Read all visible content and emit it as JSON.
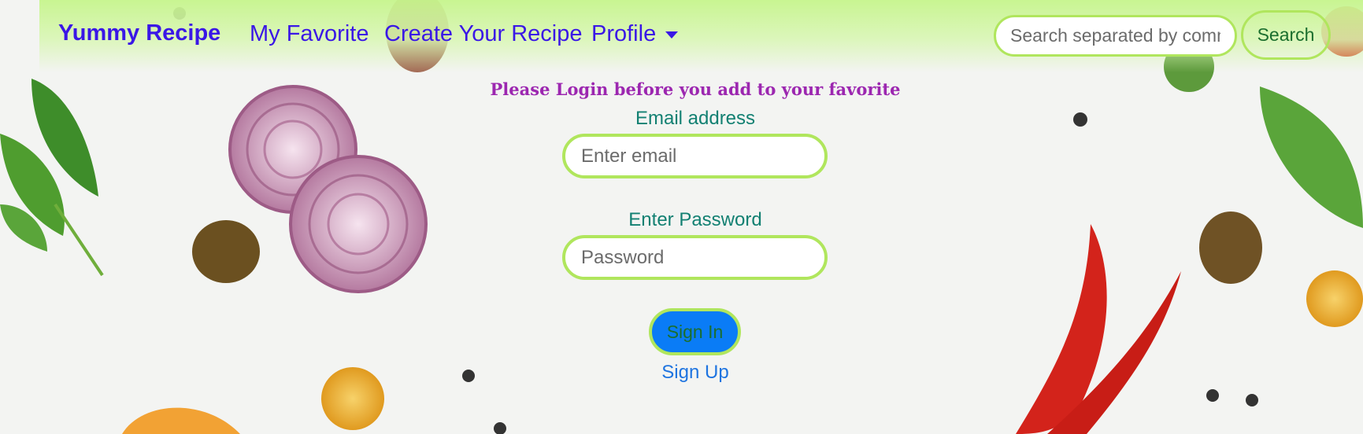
{
  "navbar": {
    "brand": "Yummy Recipe",
    "links": [
      "My Favorite",
      "Create Your Recipe",
      "Profile"
    ],
    "search_placeholder": "Search separated by comma",
    "search_button": "Search"
  },
  "login": {
    "heading": "Please Login before you add to your favorite",
    "email_label": "Email address",
    "email_placeholder": "Enter email",
    "password_label": "Enter Password",
    "password_placeholder": "Password",
    "signin_button": "Sign In",
    "signup_link": "Sign Up"
  },
  "colors": {
    "brand": "#3a17e6",
    "accent_border": "#b0e65d",
    "heading": "#9c27b0",
    "label": "#128072",
    "button_bg": "#0a7cf6"
  }
}
